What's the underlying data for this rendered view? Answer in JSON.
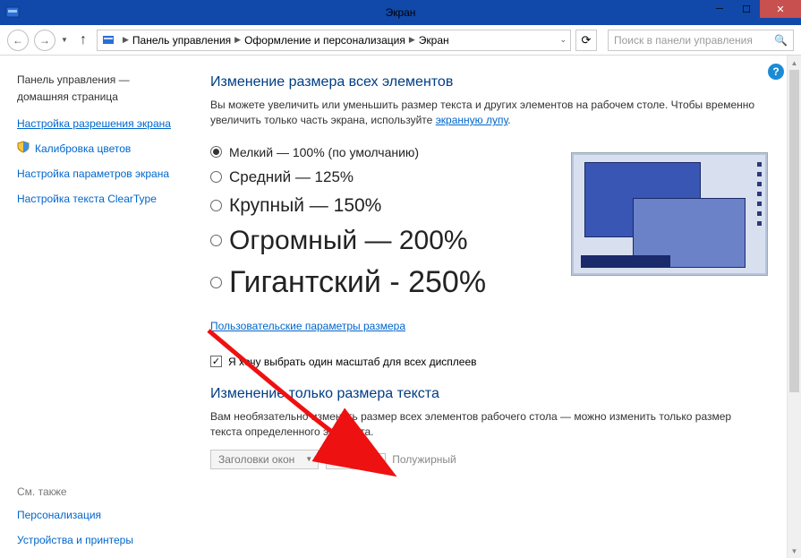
{
  "titlebar": {
    "title": "Экран"
  },
  "nav": {
    "search_placeholder": "Поиск в панели управления"
  },
  "breadcrumb": {
    "root": "Панель управления",
    "mid": "Оформление и персонализация",
    "leaf": "Экран"
  },
  "sidebar": {
    "home1": "Панель управления —",
    "home2": "домашняя страница",
    "links": [
      "Настройка разрешения экрана",
      "Калибровка цветов",
      "Настройка параметров экрана",
      "Настройка текста ClearType"
    ],
    "see_also": "См. также",
    "see_links": [
      "Персонализация",
      "Устройства и принтеры"
    ]
  },
  "content": {
    "heading1": "Изменение размера всех элементов",
    "desc1a": "Вы можете увеличить или уменьшить размер текста и других элементов на рабочем столе. Чтобы временно увеличить только часть экрана, используйте ",
    "desc1b": "экранную лупу",
    "desc1c": ".",
    "sizes": [
      {
        "label": "Мелкий — 100% (по умолчанию)",
        "selected": true
      },
      {
        "label": "Средний — 125%",
        "selected": false
      },
      {
        "label": "Крупный — 150%",
        "selected": false
      },
      {
        "label": "Огромный — 200%",
        "selected": false
      },
      {
        "label": "Гигантский - 250%",
        "selected": false
      }
    ],
    "custom_link": "Пользовательские параметры размера",
    "checkbox_label": "Я хочу выбрать один масштаб для всех дисплеев",
    "checkbox_checked": true,
    "heading2": "Изменение только размера текста",
    "desc2": "Вам необязательно изменять размер всех элементов рабочего стола — можно изменить только размер текста определенного элемента.",
    "combo_element": "Заголовки окон",
    "combo_size": "11",
    "bold_label": "Полужирный"
  }
}
